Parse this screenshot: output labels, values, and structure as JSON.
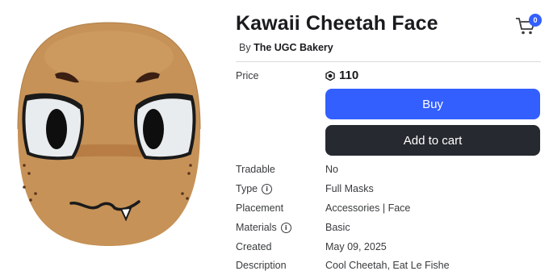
{
  "item": {
    "title": "Kawaii Cheetah Face",
    "creator_prefix": "By",
    "creator_name": "The UGC Bakery"
  },
  "cart": {
    "badge_count": "0",
    "icon": "cart-icon"
  },
  "price": {
    "label": "Price",
    "currency_icon": "robux-icon",
    "amount": "110"
  },
  "buttons": {
    "buy": "Buy",
    "add_to_cart": "Add to cart"
  },
  "details": {
    "tradable": {
      "label": "Tradable",
      "value": "No"
    },
    "type": {
      "label": "Type",
      "value": "Full Masks"
    },
    "placement": {
      "label": "Placement",
      "value": "Accessories | Face"
    },
    "materials": {
      "label": "Materials",
      "value": "Basic"
    },
    "created": {
      "label": "Created",
      "value": "May 09, 2025"
    },
    "description": {
      "label": "Description",
      "value": "Cool Cheetah, Eat Le Fishe"
    }
  },
  "colors": {
    "primary_button": "#335fff",
    "secondary_button": "#272930",
    "badge": "#335fff"
  }
}
